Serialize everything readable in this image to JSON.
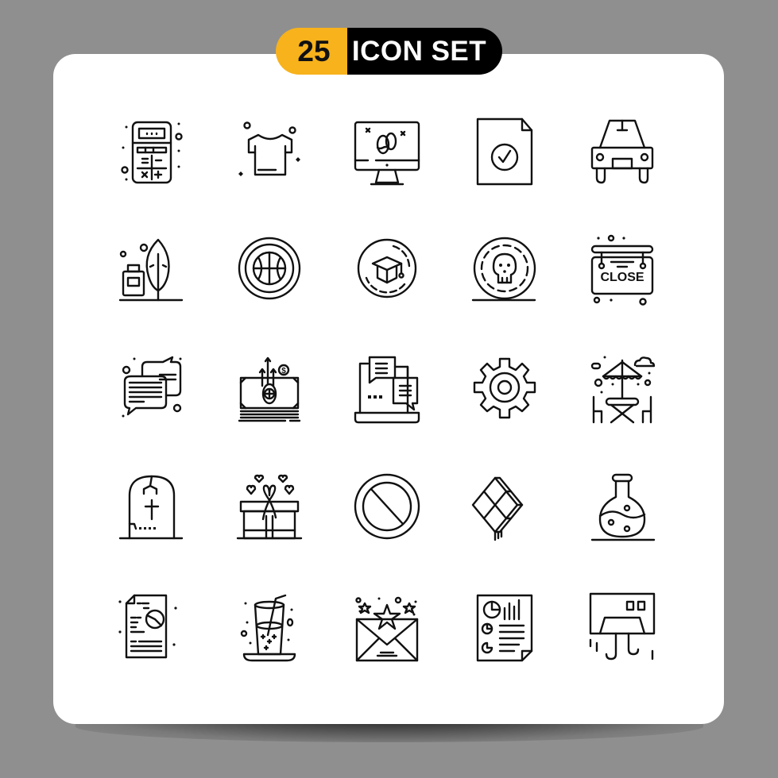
{
  "header": {
    "count": "25",
    "title": "ICON SET",
    "accent_color": "#f7b21c",
    "badge_dark_color": "#000000"
  },
  "background_color": "#8f8f8f",
  "card_color": "#ffffff",
  "icons": [
    {
      "row": 1,
      "col": 1,
      "name": "calculator-icon"
    },
    {
      "row": 1,
      "col": 2,
      "name": "tshirt-icon"
    },
    {
      "row": 1,
      "col": 3,
      "name": "monitor-easter-eggs-icon"
    },
    {
      "row": 1,
      "col": 4,
      "name": "document-check-icon"
    },
    {
      "row": 1,
      "col": 5,
      "name": "car-front-icon"
    },
    {
      "row": 2,
      "col": 1,
      "name": "ink-bottle-feather-icon"
    },
    {
      "row": 2,
      "col": 2,
      "name": "basketball-circle-icon"
    },
    {
      "row": 2,
      "col": 3,
      "name": "graduation-cap-circle-icon"
    },
    {
      "row": 2,
      "col": 4,
      "name": "skull-circle-icon"
    },
    {
      "row": 2,
      "col": 5,
      "name": "close-sign-icon",
      "text": "CLOSE"
    },
    {
      "row": 3,
      "col": 1,
      "name": "chat-bubbles-icon"
    },
    {
      "row": 3,
      "col": 2,
      "name": "money-stack-growth-icon",
      "text": "$"
    },
    {
      "row": 3,
      "col": 3,
      "name": "laptop-chat-icon"
    },
    {
      "row": 3,
      "col": 4,
      "name": "gear-icon"
    },
    {
      "row": 3,
      "col": 5,
      "name": "cafe-table-umbrella-icon"
    },
    {
      "row": 4,
      "col": 1,
      "name": "tombstone-icon"
    },
    {
      "row": 4,
      "col": 2,
      "name": "gift-box-hearts-icon"
    },
    {
      "row": 4,
      "col": 3,
      "name": "prohibited-sign-icon"
    },
    {
      "row": 4,
      "col": 4,
      "name": "kite-icon"
    },
    {
      "row": 4,
      "col": 5,
      "name": "chemistry-flask-icon"
    },
    {
      "row": 5,
      "col": 1,
      "name": "report-pie-chart-icon"
    },
    {
      "row": 5,
      "col": 2,
      "name": "drink-glass-straw-icon"
    },
    {
      "row": 5,
      "col": 3,
      "name": "envelope-stars-icon"
    },
    {
      "row": 5,
      "col": 4,
      "name": "analytics-report-icon"
    },
    {
      "row": 5,
      "col": 5,
      "name": "air-conditioner-icon"
    }
  ]
}
